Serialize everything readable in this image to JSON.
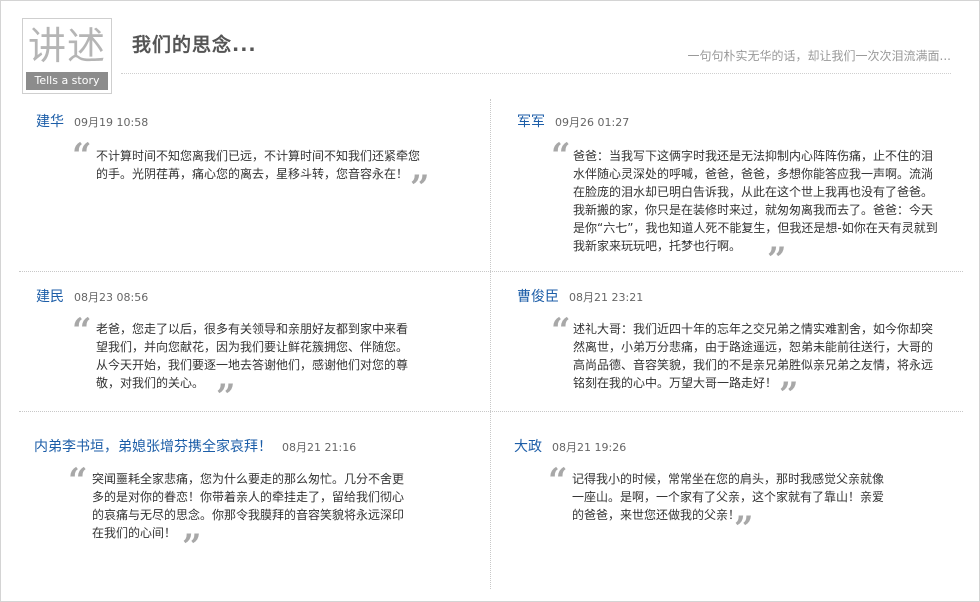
{
  "header": {
    "logo_glyphs": "讲述",
    "logo_caption": "Tells a story",
    "title": "我们的思念...",
    "tagline": "一句句朴实无华的话，却让我们一次次泪流满面..."
  },
  "quote_marks": {
    "open": "“",
    "close": "”"
  },
  "entries": [
    {
      "name": "建华",
      "time": "09月19 10:58",
      "text": "不计算时间不知您离我们已远，不计算时间不知我们还紧牵您的手。光阴荏苒，痛心您的离去，星移斗转，您音容永在！"
    },
    {
      "name": "军军",
      "time": "09月26 01:27",
      "text": "爸爸：当我写下这俩字时我还是无法抑制内心阵阵伤痛，止不住的泪水伴随心灵深处的呼喊，爸爸，爸爸，多想你能答应我一声啊。流淌在脸庞的泪水却已明白告诉我，从此在这个世上我再也没有了爸爸。我新搬的家，你只是在装修时来过，就匆匆离我而去了。爸爸：今天是你“六七”，我也知道人死不能复生，但我还是想-如你在天有灵就到我新家来玩玩吧，托梦也行啊。"
    },
    {
      "name": "建民",
      "time": "08月23 08:56",
      "text": "老爸，您走了以后，很多有关领导和亲朋好友都到家中来看望我们，并向您献花，因为我们要让鲜花簇拥您、伴随您。从今天开始，我们要逐一地去答谢他们，感谢他们对您的尊敬，对我们的关心。"
    },
    {
      "name": "曹俊臣",
      "time": "08月21 23:21",
      "text": "述礼大哥：我们近四十年的忘年之交兄弟之情实难割舍，如今你却突然离世，小弟万分悲痛，由于路途遥远，恕弟未能前往送行，大哥的高尚品德、音容笑貌，我们的不是亲兄弟胜似亲兄弟之友情，将永远铭刻在我的心中。万望大哥一路走好！"
    },
    {
      "name": "内弟李书垣，弟媳张增芬携全家哀拜！",
      "time": "08月21 21:16",
      "text": "突闻噩耗全家悲痛，您为什么要走的那么匆忙。几分不舍更多的是对你的眷恋！你带着亲人的牵挂走了，留给我们彻心的哀痛与无尽的思念。你那令我膜拜的音容笑貌将永远深印在我们的心间！"
    },
    {
      "name": "大政",
      "time": "08月21 19:26",
      "text": "记得我小的时候，常常坐在您的肩头，那时我感觉父亲就像一座山。是啊，一个家有了父亲，这个家就有了靠山！亲爱的爸爸，来世您还做我的父亲！"
    }
  ]
}
